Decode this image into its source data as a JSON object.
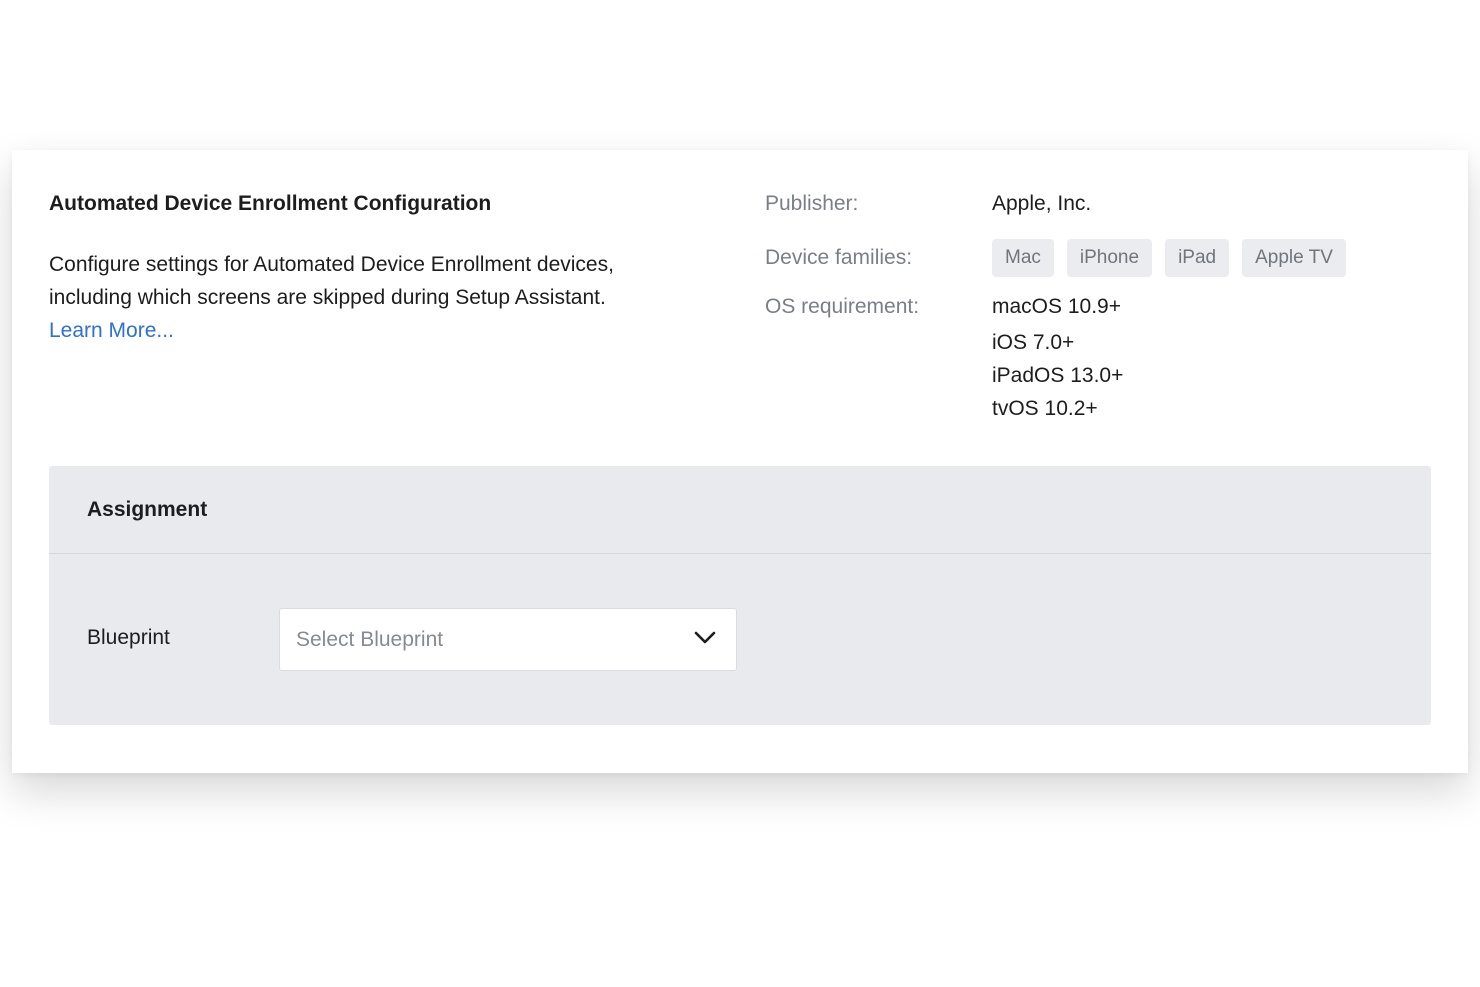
{
  "config": {
    "title": "Automated Device Enrollment Configuration",
    "description_line1": "Configure settings for Automated Device Enrollment devices,",
    "description_line2": "including which screens are skipped during Setup Assistant.",
    "learn_more": "Learn More..."
  },
  "meta": {
    "publisher_label": "Publisher:",
    "publisher_value": "Apple, Inc.",
    "families_label": "Device families:",
    "families": [
      "Mac",
      "iPhone",
      "iPad",
      "Apple TV"
    ],
    "os_label": "OS requirement:",
    "os": [
      "macOS 10.9+",
      "iOS 7.0+",
      "iPadOS 13.0+",
      "tvOS 10.2+"
    ]
  },
  "assignment": {
    "title": "Assignment",
    "blueprint_label": "Blueprint",
    "blueprint_placeholder": "Select Blueprint",
    "chevron_icon": "chevron-down-icon"
  },
  "colors": {
    "link": "#2f6fd6",
    "chip_bg": "#ebecf0",
    "panel_bg": "#e9eaee"
  }
}
